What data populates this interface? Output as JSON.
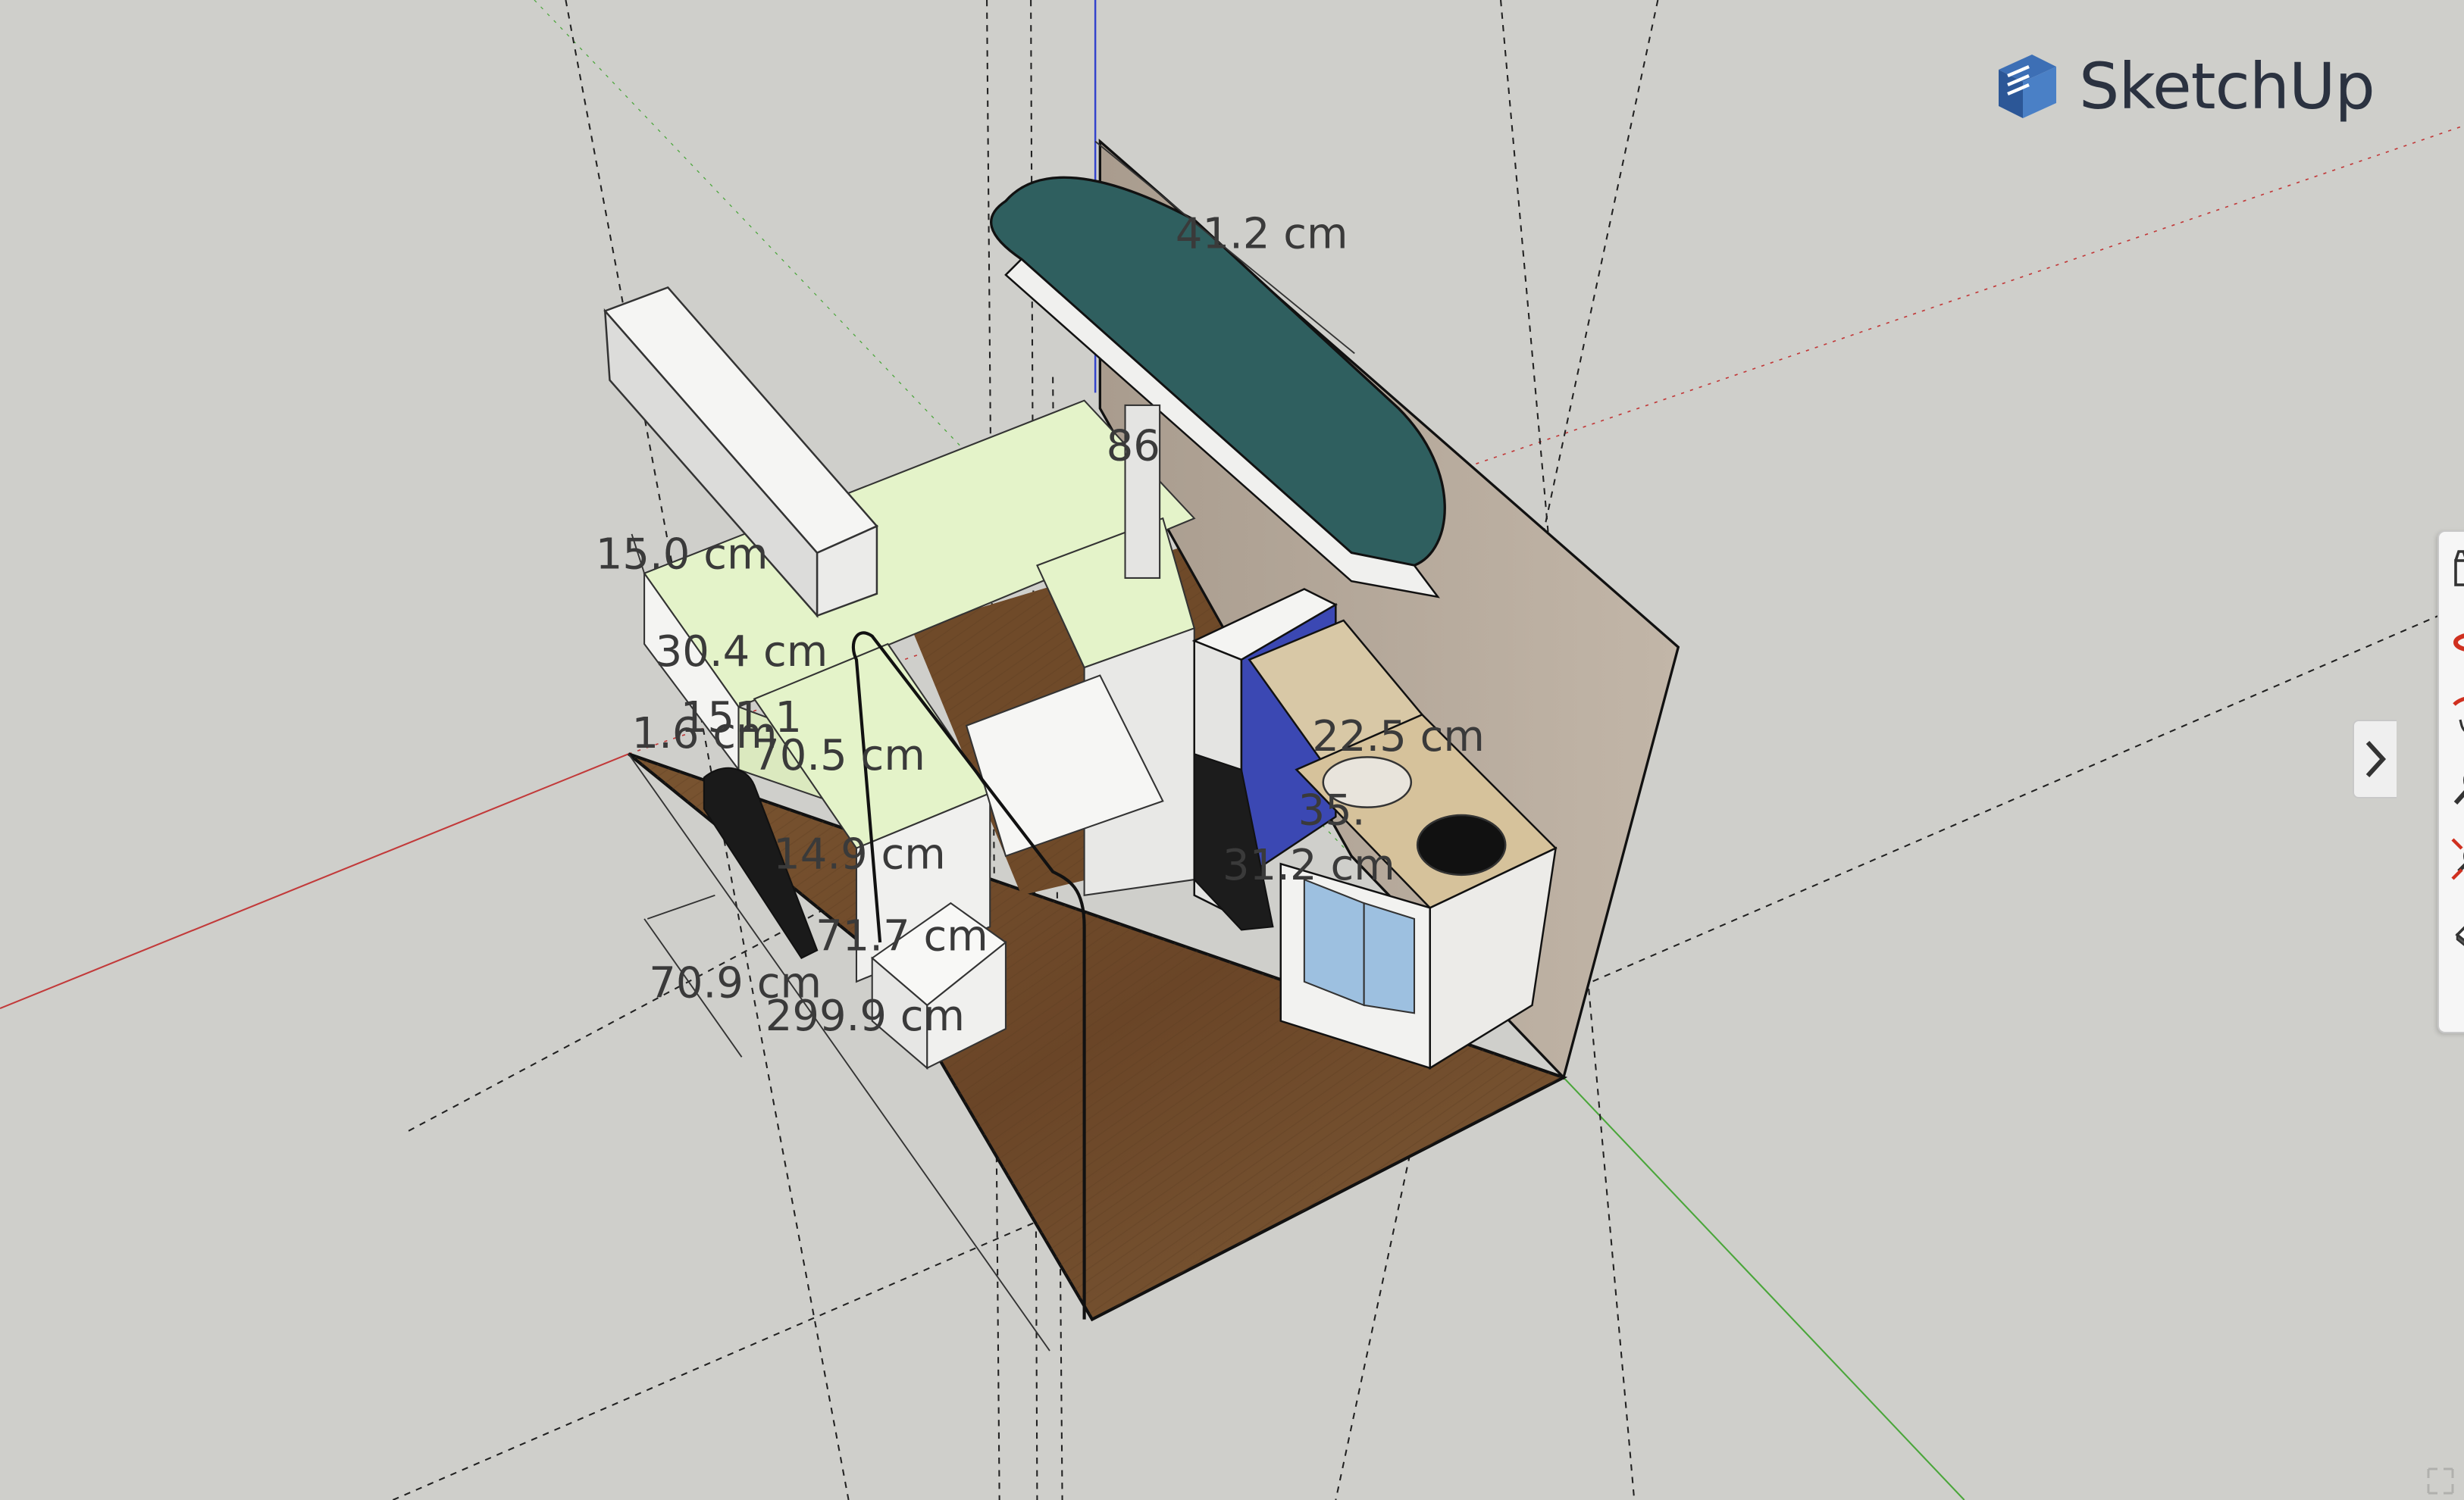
{
  "app": {
    "brand": "SketchUp",
    "logo_icon": "sketchup-logo-icon"
  },
  "dimensions": {
    "d1": "41.2 cm",
    "d2": "86",
    "d3": "15.0 cm",
    "d4": "30.4 cm",
    "d5": "151.1",
    "d6": "1.6 cm",
    "d7": "70.5 cm",
    "d8": "14.9 cm",
    "d9": "71.7 cm",
    "d10": "70.9 cm",
    "d11": "299.9 cm",
    "d12": "22.5 cm",
    "d13": "35.",
    "d14": "31.2 cm"
  },
  "toolbar": {
    "tools": [
      {
        "name": "scenes-icon"
      },
      {
        "name": "orbit-icon"
      },
      {
        "name": "pan-icon"
      },
      {
        "name": "zoom-icon"
      },
      {
        "name": "zoom-extents-icon"
      },
      {
        "name": "eraser-icon"
      }
    ],
    "expand_icon": "chevron-right-icon"
  },
  "colors": {
    "background": "#cfcfcb",
    "floor": "#6b4a2b",
    "bed": "#e4f3c9",
    "table": "#2f5f5f",
    "wall": "#b9ada0",
    "counter": "#d7c39c",
    "accent_blue": "#3b48b3"
  }
}
